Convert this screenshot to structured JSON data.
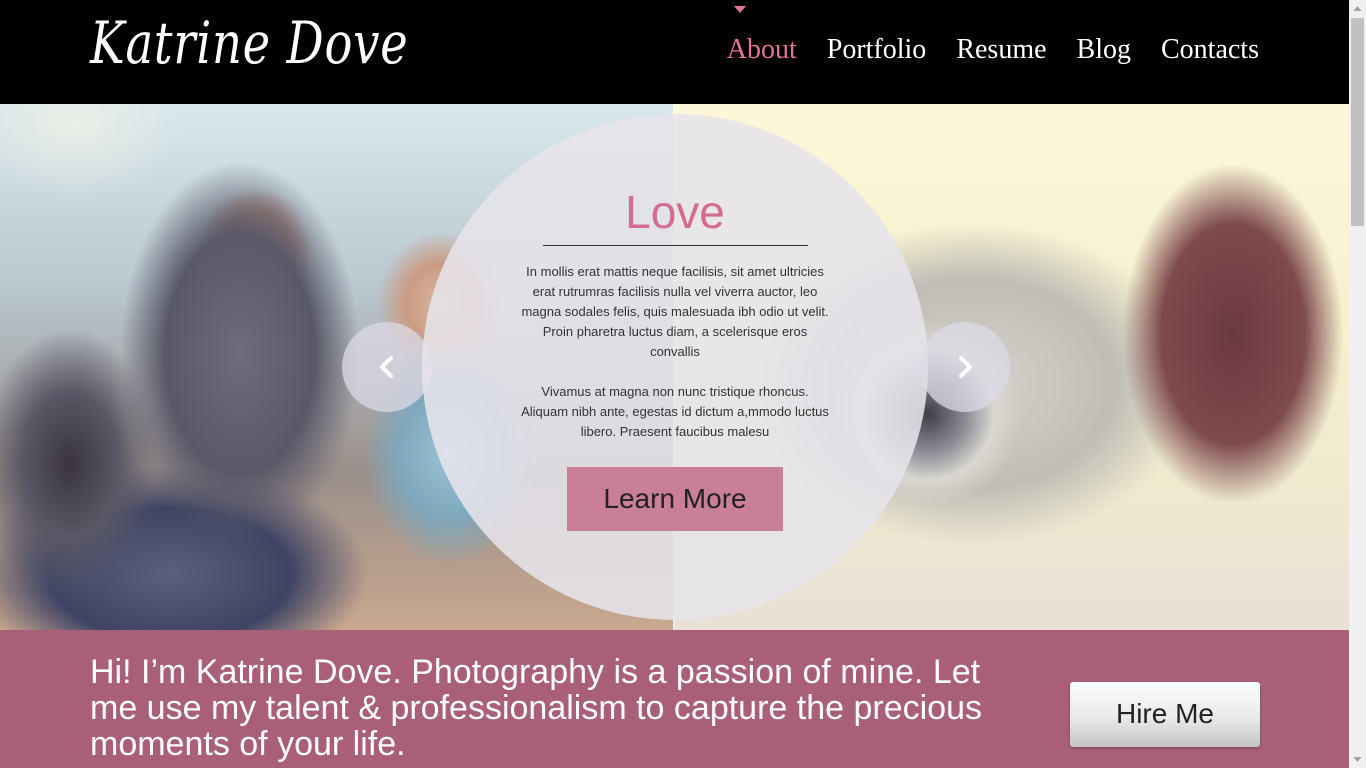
{
  "header": {
    "logo": "Katrine Dove",
    "nav": [
      "About",
      "Portfolio",
      "Resume",
      "Blog",
      "Contacts"
    ],
    "active_nav": "About"
  },
  "hero": {
    "title": "Love",
    "paragraph1": "In mollis erat mattis neque facilisis, sit amet ultricies erat rutrumras facilisis nulla vel viverra auctor, leo magna sodales felis, quis malesuada ibh odio ut velit. Proin pharetra luctus diam, a scelerisque eros convallis",
    "paragraph2": "Vivamus at magna non nunc tristique rhoncus. Aliquam nibh ante, egestas id dictum a,mmodo luctus libero. Praesent faucibus malesu",
    "button_label": "Learn More",
    "prev_icon": "chevron-left-icon",
    "next_icon": "chevron-right-icon"
  },
  "band": {
    "intro": "Hi! I’m Katrine Dove. Photography is a passion of mine. Let me use my talent & professionalism to capture the precious moments of your life.",
    "hire_label": "Hire Me"
  },
  "colors": {
    "accent": "#e0739a",
    "band": "#a95f75",
    "button": "#c97f96"
  }
}
